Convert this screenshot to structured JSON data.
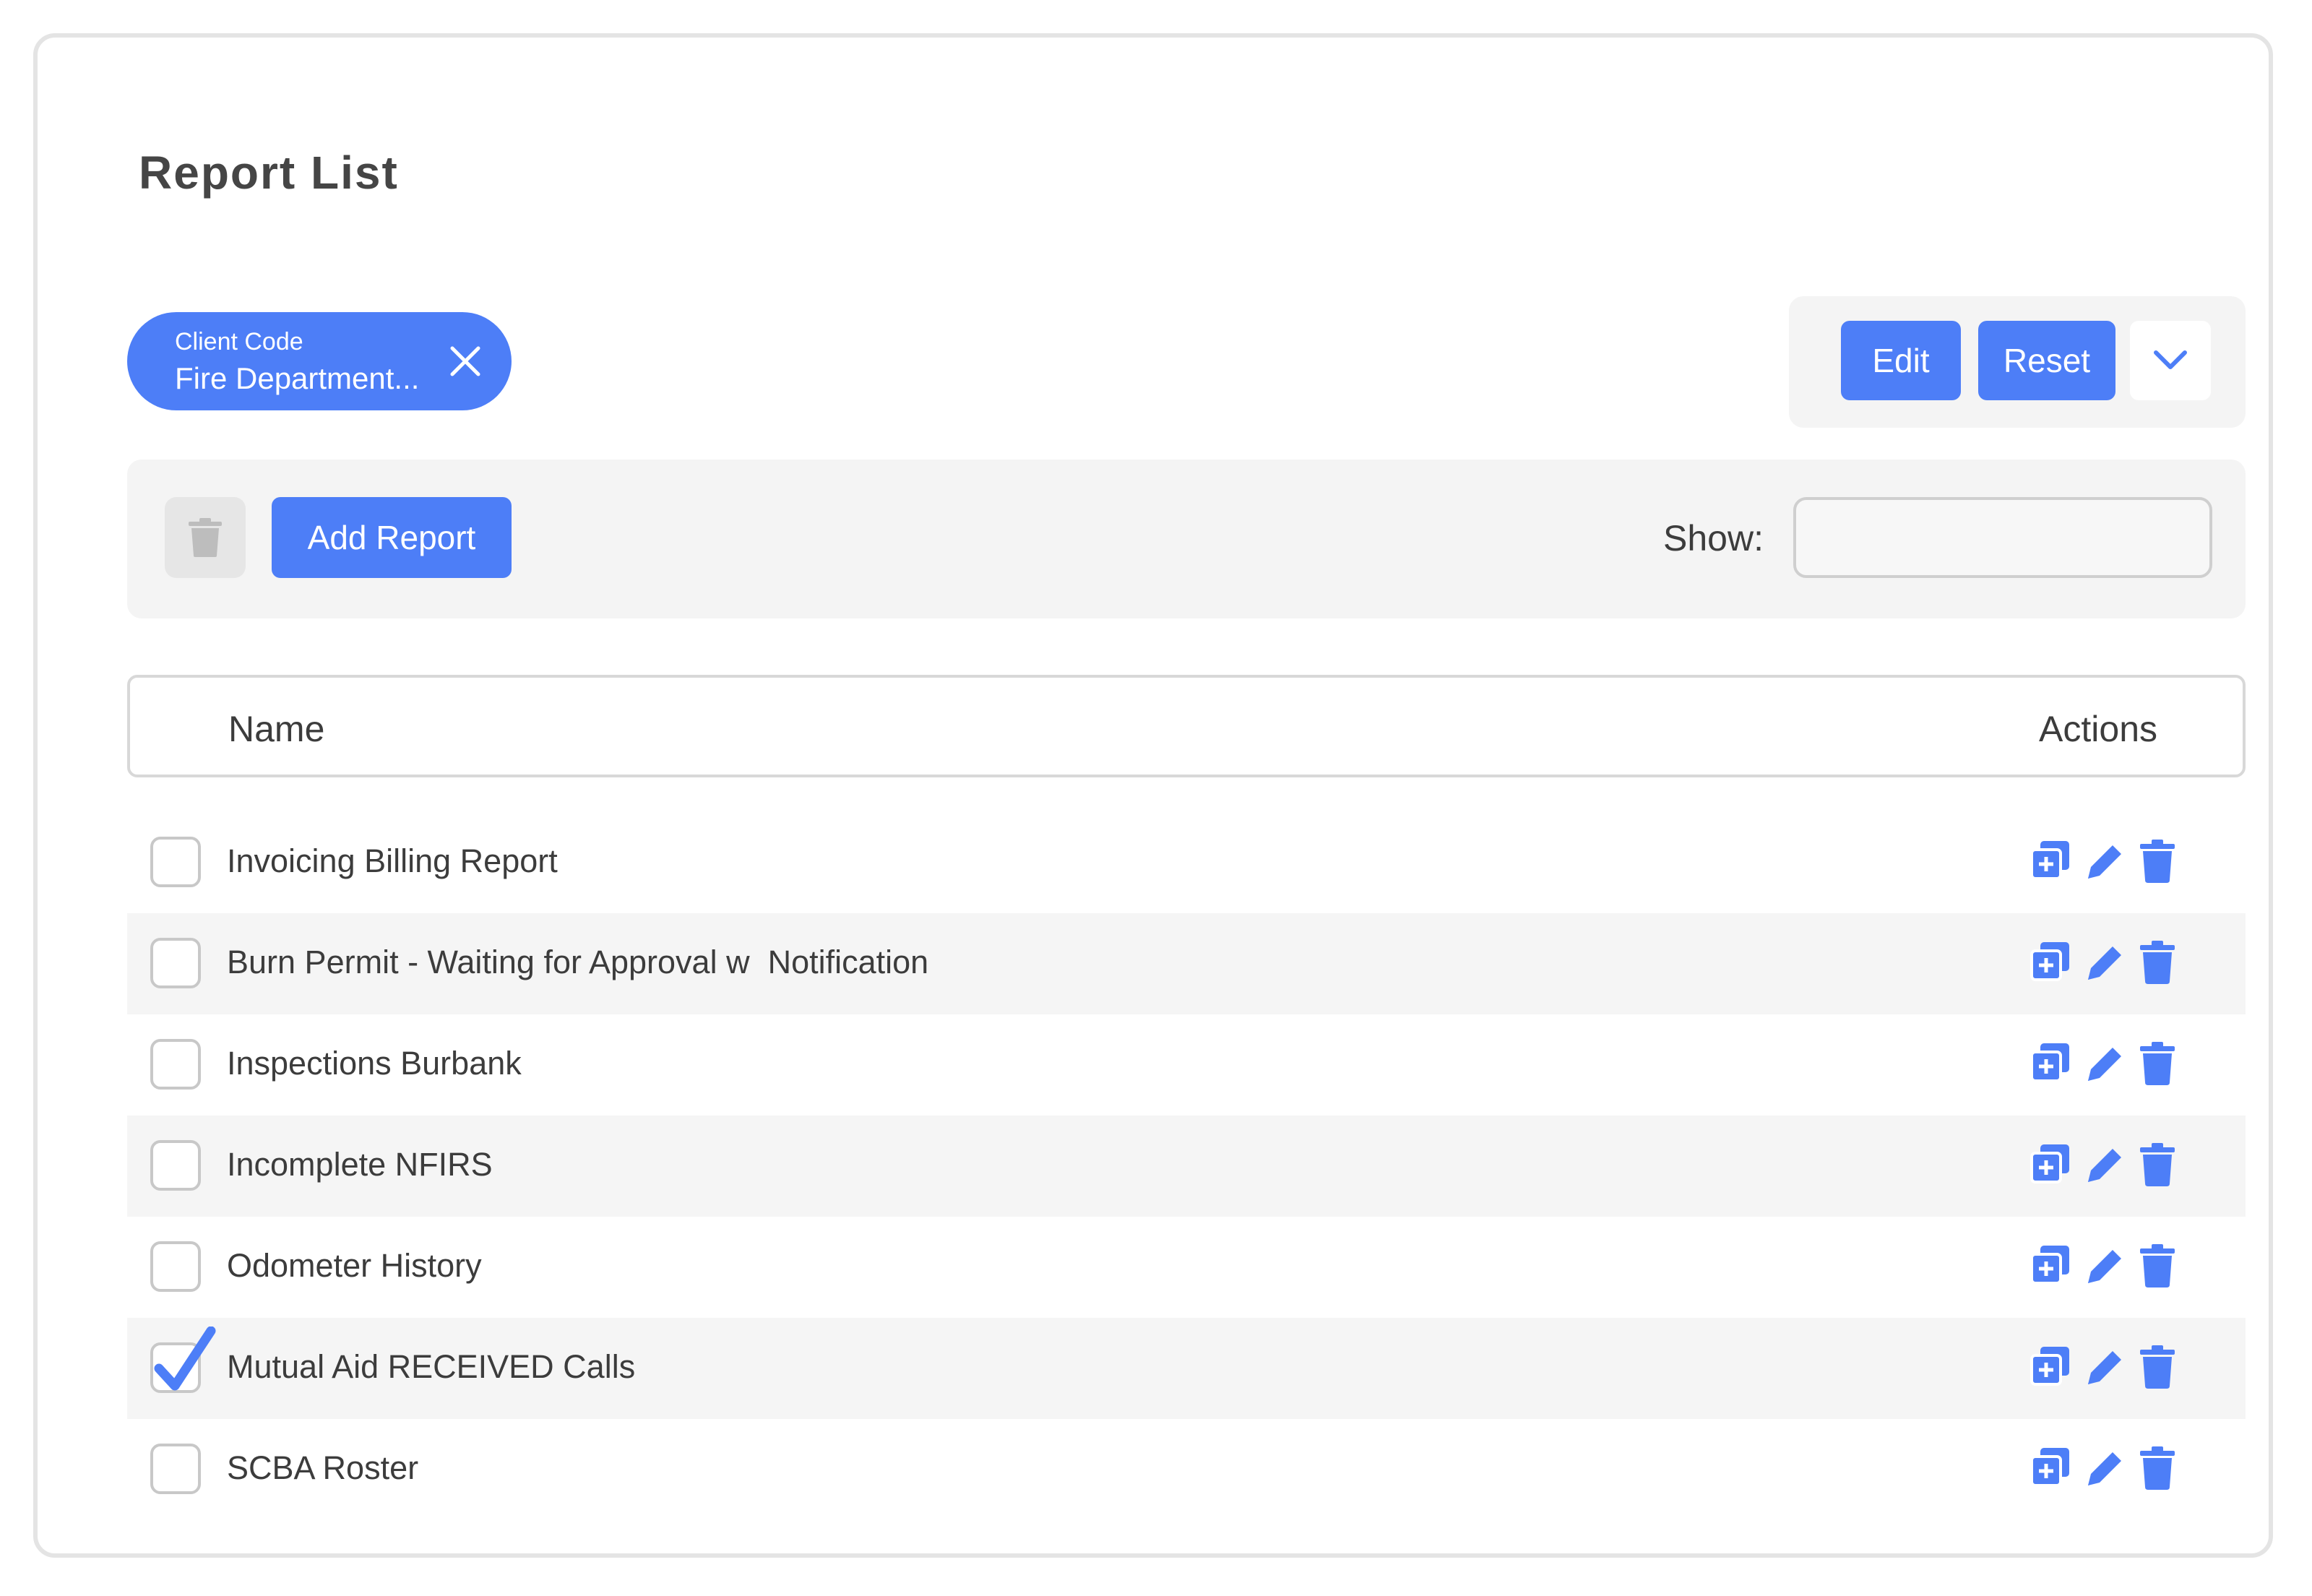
{
  "page": {
    "title": "Report List"
  },
  "filter_chip": {
    "label": "Client Code",
    "value": "Fire Department..."
  },
  "header_actions": {
    "edit_label": "Edit",
    "reset_label": "Reset"
  },
  "toolbar": {
    "add_label": "Add Report",
    "show_label": "Show:",
    "show_value": ""
  },
  "table": {
    "columns": {
      "name": "Name",
      "actions": "Actions"
    },
    "rows": [
      {
        "name": "Invoicing Billing Report",
        "checked": false
      },
      {
        "name": "Burn Permit - Waiting for Approval w  Notification",
        "checked": false
      },
      {
        "name": "Inspections Burbank",
        "checked": false
      },
      {
        "name": "Incomplete NFIRS",
        "checked": false
      },
      {
        "name": "Odometer History",
        "checked": false
      },
      {
        "name": "Mutual Aid RECEIVED Calls",
        "checked": true
      },
      {
        "name": "SCBA Roster",
        "checked": false
      }
    ]
  },
  "colors": {
    "accent": "#4d7ef7",
    "panel": "#f4f4f4",
    "row_alt": "#f5f5f5"
  },
  "icons": {
    "chip": "close-icon",
    "dropdown": "chevron-down-icon",
    "toolbar": "trash-icon",
    "row_actions": [
      "copy-add-icon",
      "pencil-icon",
      "trash-icon"
    ]
  }
}
